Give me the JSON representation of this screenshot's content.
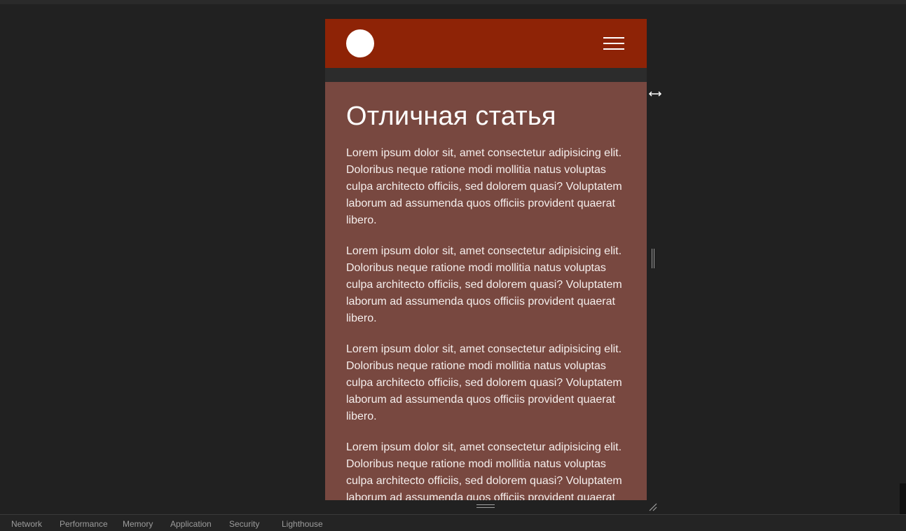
{
  "page": {
    "title": "Отличная статья",
    "paragraphs": [
      "Lorem ipsum dolor sit, amet consectetur adipisicing elit. Doloribus neque ratione modi mollitia natus voluptas culpa architecto officiis, sed dolorem quasi? Voluptatem laborum ad assumenda quos officiis provident quaerat libero.",
      "Lorem ipsum dolor sit, amet consectetur adipisicing elit. Doloribus neque ratione modi mollitia natus voluptas culpa architecto officiis, sed dolorem quasi? Voluptatem laborum ad assumenda quos officiis provident quaerat libero.",
      "Lorem ipsum dolor sit, amet consectetur adipisicing elit. Doloribus neque ratione modi mollitia natus voluptas culpa architecto officiis, sed dolorem quasi? Voluptatem laborum ad assumenda quos officiis provident quaerat libero.",
      "Lorem ipsum dolor sit, amet consectetur adipisicing elit. Doloribus neque ratione modi mollitia natus voluptas culpa architecto officiis, sed dolorem quasi? Voluptatem laborum ad assumenda quos officiis provident quaerat libero."
    ]
  },
  "header": {
    "logo_icon": "circle-logo-icon",
    "menu_icon": "hamburger-menu-icon"
  },
  "devtools": {
    "tabs": [
      "Network",
      "Performance",
      "Memory",
      "Application",
      "Security",
      "Lighthouse"
    ]
  },
  "colors": {
    "header_bg": "#8e2306",
    "article_bg": "#784840",
    "background": "#212121"
  }
}
